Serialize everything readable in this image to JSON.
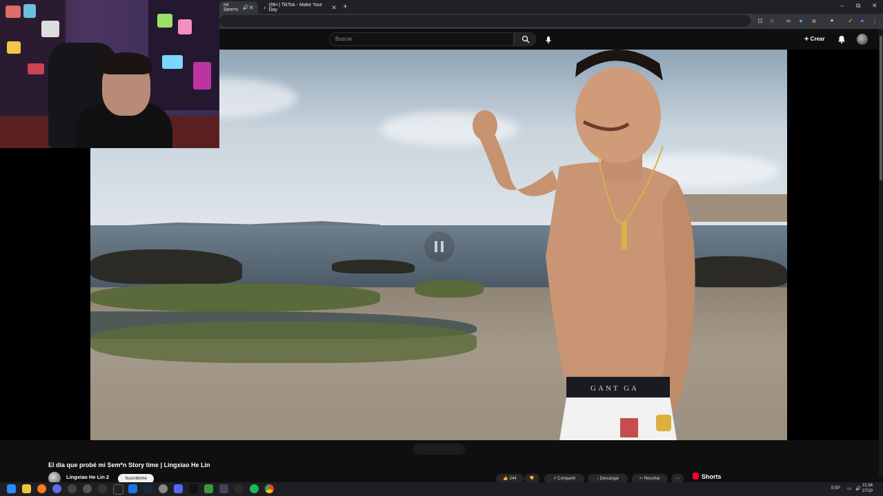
{
  "browser": {
    "tabs": [
      {
        "label": "mi Sem*n",
        "active": true
      },
      {
        "label": "(99+) TikTok - Make Your Day",
        "active": false
      }
    ],
    "new_tab": "+",
    "tab_close": "✕",
    "window_controls": [
      "–",
      "⧉",
      "✕"
    ]
  },
  "youtube": {
    "search_placeholder": "Buscar",
    "create_label": "Crear",
    "video_title": "El día que probé mi Sem*n Story time | Lingxiao He Lin",
    "channel_name": "Lingxiao He Lin 2",
    "subscribe_label": "Suscribirme",
    "like_count": "244",
    "share_label": "Compartir",
    "download_label": "Descargar",
    "clip_label": "Recortar",
    "shorts_label": "Shorts"
  },
  "taskbar": {
    "language": "ESP",
    "time": "21:34",
    "date": "27/10"
  },
  "colors": {
    "background": "#0f0f0f",
    "shorts_red": "#ff0033",
    "chrome_dark": "#202124"
  }
}
